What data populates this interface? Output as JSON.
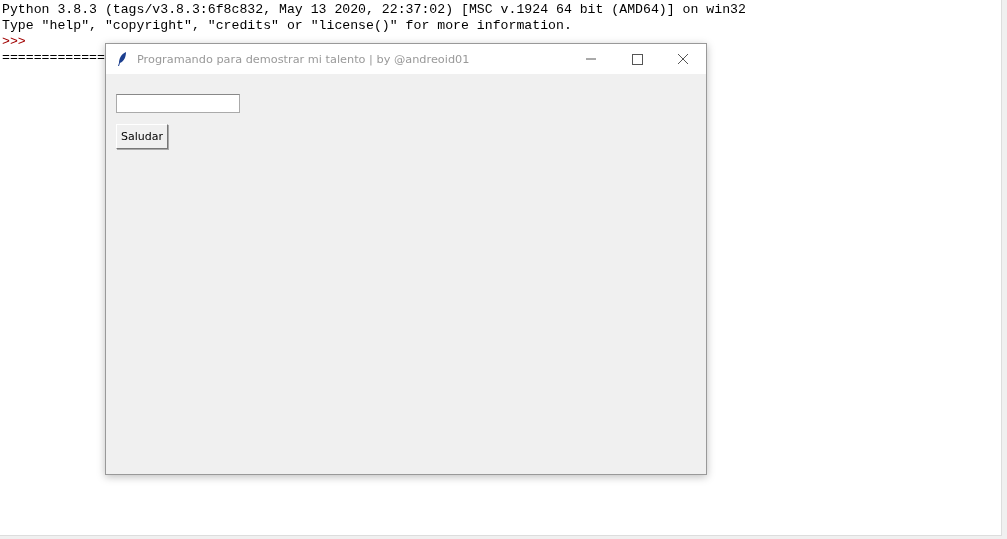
{
  "shell": {
    "lines": [
      {
        "kind": "output",
        "text": "Python 3.8.3 (tags/v3.8.3:6f8c832, May 13 2020, 22:37:02) [MSC v.1924 64 bit (AMD64)] on win32"
      },
      {
        "kind": "output",
        "text": "Type \"help\", \"copyright\", \"credits\" or \"license()\" for more information."
      },
      {
        "kind": "prompt",
        "text": ">>>"
      },
      {
        "kind": "output",
        "text": "============="
      }
    ]
  },
  "window": {
    "title": "Programando para demostrar mi talento | by @andreoid01",
    "button": "Saludar"
  }
}
